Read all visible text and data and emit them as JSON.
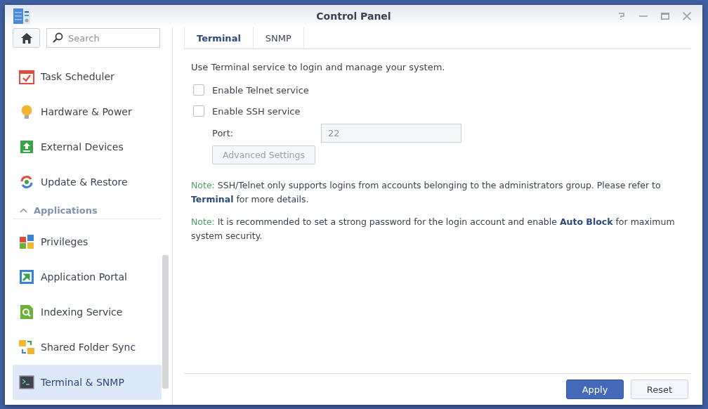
{
  "window": {
    "title": "Control Panel"
  },
  "search": {
    "placeholder": "Search"
  },
  "sidebar": {
    "sections": [
      {
        "items": [
          {
            "label": "Task Scheduler",
            "selected": false
          },
          {
            "label": "Hardware & Power",
            "selected": false
          },
          {
            "label": "External Devices",
            "selected": false
          },
          {
            "label": "Update & Restore",
            "selected": false
          }
        ]
      },
      {
        "title": "Applications",
        "expanded": true,
        "items": [
          {
            "label": "Privileges",
            "selected": false
          },
          {
            "label": "Application Portal",
            "selected": false
          },
          {
            "label": "Indexing Service",
            "selected": false
          },
          {
            "label": "Shared Folder Sync",
            "selected": false
          },
          {
            "label": "Terminal & SNMP",
            "selected": true
          }
        ]
      }
    ]
  },
  "tabs": [
    {
      "label": "Terminal",
      "selected": true
    },
    {
      "label": "SNMP",
      "selected": false
    }
  ],
  "intro": "Use Terminal service to login and manage your system.",
  "options": [
    {
      "label": "Enable Telnet service",
      "checked": false
    },
    {
      "label": "Enable SSH service",
      "checked": false
    }
  ],
  "port": {
    "label": "Port:",
    "value": "22",
    "disabled": true
  },
  "advanced_button": {
    "label": "Advanced Settings",
    "disabled": true
  },
  "notes": [
    {
      "prefix": "Note:",
      "before": "SSH/Telnet only supports logins from accounts belonging to the administrators group. Please refer to",
      "link": "Terminal",
      "after": "for more details."
    },
    {
      "prefix": "Note:",
      "before": "It is recommended to set a strong password for the login account and enable",
      "link": "Auto Block",
      "after": "for maximum system security."
    }
  ],
  "buttons": [
    {
      "label": "Apply",
      "kind": "primary"
    },
    {
      "label": "Reset",
      "kind": "secondary"
    }
  ]
}
